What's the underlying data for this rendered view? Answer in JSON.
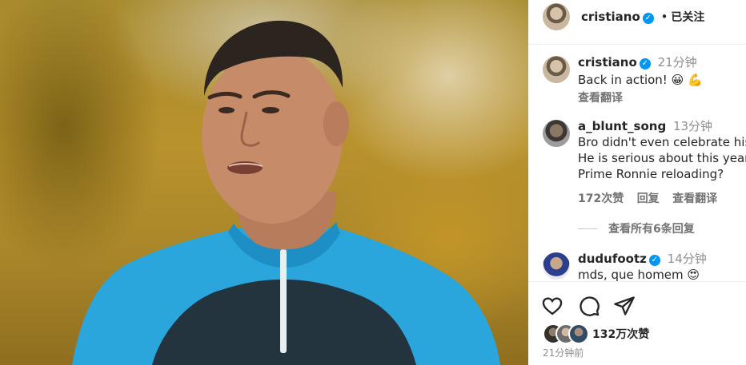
{
  "post": {
    "author": "cristiano",
    "follow_status": "已关注",
    "separator": "•",
    "likes": "132万次赞",
    "posted_ago": "21分钟前"
  },
  "caption": {
    "author": "cristiano",
    "time": "21分钟",
    "text": "Back in action! 😀 💪",
    "translate": "查看翻译"
  },
  "comments": [
    {
      "author": "a_blunt_song",
      "time": "13分钟",
      "lines": [
        "Bro didn't even celebrate his",
        "He is serious about this year",
        "Prime Ronnie reloading?"
      ],
      "likes": "172次赞",
      "reply": "回复",
      "translate": "查看翻译"
    },
    {
      "author": "dudufootz",
      "time": "14分钟",
      "text": "mds, que homem 😍"
    }
  ],
  "view_replies": "查看所有6条回复",
  "icons": {
    "like": "heart-icon",
    "comment": "comment-icon",
    "share": "share-icon",
    "verified": "verified-badge-icon"
  },
  "colors": {
    "verified_blue": "#0095f6",
    "text": "#262626",
    "muted": "#8e8e8e",
    "jersey_blue": "#2aa6dc"
  }
}
